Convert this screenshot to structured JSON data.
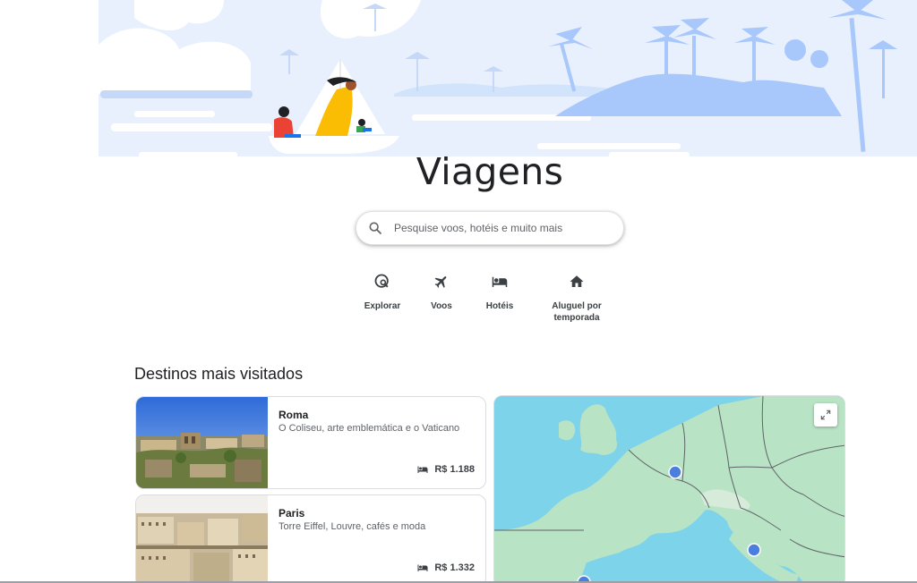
{
  "page": {
    "title": "Viagens"
  },
  "search": {
    "placeholder": "Pesquise voos, hotéis e muito mais",
    "icon": "search-icon"
  },
  "quick_links": [
    {
      "label": "Explorar",
      "icon": "explore-icon"
    },
    {
      "label": "Voos",
      "icon": "flight-icon"
    },
    {
      "label": "Hotéis",
      "icon": "hotel-icon"
    },
    {
      "label_line1": "Aluguel por",
      "label_line2": "temporada",
      "icon": "home-icon"
    }
  ],
  "destinations": {
    "title": "Destinos mais visitados",
    "items": [
      {
        "name": "Roma",
        "description": "O Coliseu, arte emblemática e o Vaticano",
        "price": "R$ 1.188",
        "price_icon": "hotel-icon"
      },
      {
        "name": "Paris",
        "description": "Torre Eiffel, Louvre, cafés e moda",
        "price": "R$ 1.332",
        "price_icon": "hotel-icon"
      }
    ]
  },
  "map": {
    "expand_icon": "expand-icon",
    "marker_color": "#4a7fe0"
  },
  "colors": {
    "hero_sky": "#e8f0fe",
    "hero_island": "#a8c7fa",
    "accent": "#1a73e8"
  }
}
